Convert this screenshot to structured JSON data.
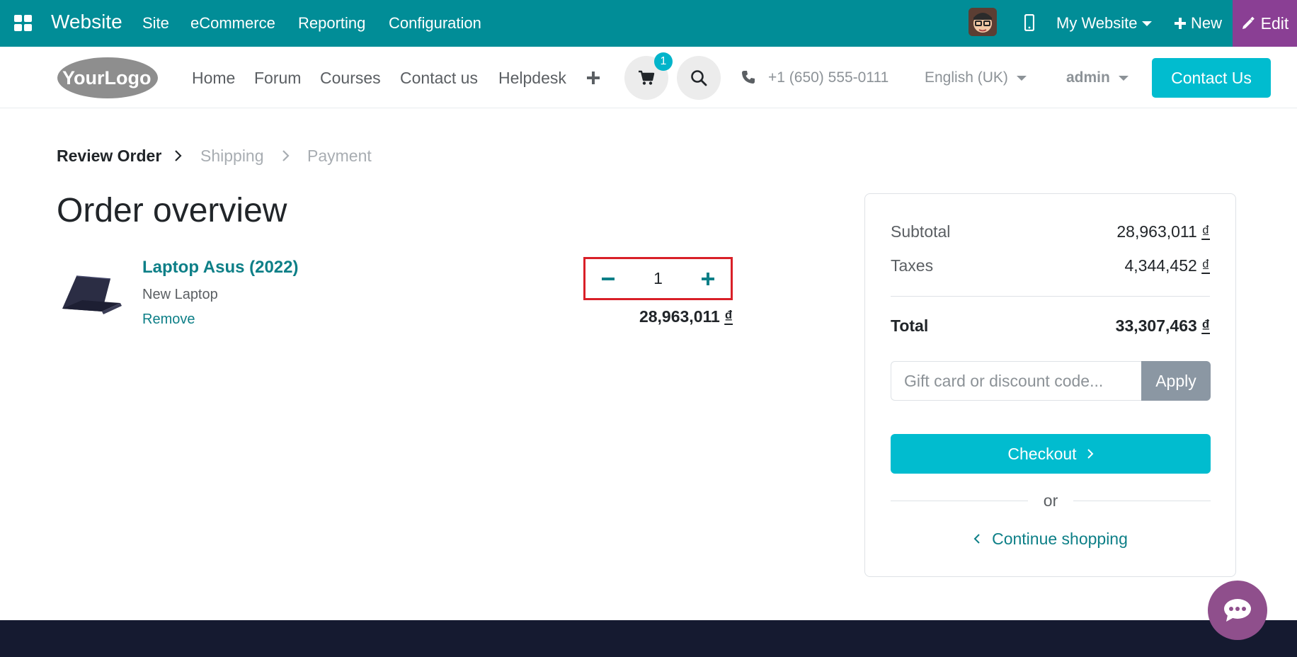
{
  "topbar": {
    "app_name": "Website",
    "menu": [
      "Site",
      "eCommerce",
      "Reporting",
      "Configuration"
    ],
    "site_switch": "My Website",
    "new_label": "New",
    "edit_label": "Edit"
  },
  "header": {
    "logo_text": "YourLogo",
    "nav": [
      "Home",
      "Forum",
      "Courses",
      "Contact us",
      "Helpdesk"
    ],
    "cart_count": "1",
    "phone": "+1 (650) 555-0111",
    "language": "English (UK)",
    "user": "admin",
    "contact_btn": "Contact Us"
  },
  "steps": [
    "Review Order",
    "Shipping",
    "Payment"
  ],
  "page_title": "Order overview",
  "cart_line": {
    "name": "Laptop Asus (2022)",
    "description": "New Laptop",
    "remove": "Remove",
    "quantity": "1",
    "price": "28,963,011",
    "currency": "₫"
  },
  "summary": {
    "subtotal_label": "Subtotal",
    "subtotal_value": "28,963,011",
    "taxes_label": "Taxes",
    "taxes_value": "4,344,452",
    "total_label": "Total",
    "total_value": "33,307,463",
    "currency": "₫",
    "coupon_placeholder": "Gift card or discount code...",
    "apply": "Apply",
    "checkout": "Checkout",
    "or": "or",
    "continue": "Continue shopping"
  },
  "colors": {
    "topbar": "#018d97",
    "edit": "#8a3f94",
    "accent": "#01bccf",
    "link": "#0d7f87",
    "footer": "#151a30",
    "chat": "#8f4f8c"
  }
}
